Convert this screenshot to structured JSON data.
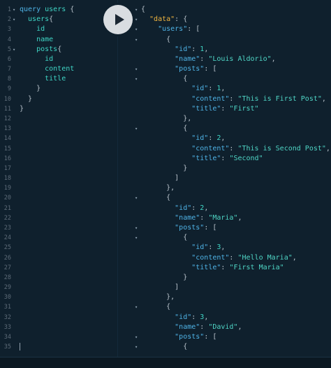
{
  "editor": {
    "lines": [
      {
        "n": "1",
        "fold": "▾",
        "indent": 0,
        "parts": [
          {
            "c": "kw",
            "t": "query"
          },
          {
            "c": "op",
            "t": " "
          },
          {
            "c": "fld",
            "t": "users"
          },
          {
            "c": "op",
            "t": " {"
          }
        ]
      },
      {
        "n": "2",
        "fold": "▾",
        "indent": 2,
        "parts": [
          {
            "c": "fld",
            "t": "users"
          },
          {
            "c": "op",
            "t": "{"
          }
        ]
      },
      {
        "n": "3",
        "fold": "",
        "indent": 4,
        "parts": [
          {
            "c": "fld",
            "t": "id"
          }
        ]
      },
      {
        "n": "4",
        "fold": "",
        "indent": 4,
        "parts": [
          {
            "c": "fld",
            "t": "name"
          }
        ]
      },
      {
        "n": "5",
        "fold": "▾",
        "indent": 4,
        "parts": [
          {
            "c": "fld",
            "t": "posts"
          },
          {
            "c": "op",
            "t": "{"
          }
        ]
      },
      {
        "n": "6",
        "fold": "",
        "indent": 6,
        "parts": [
          {
            "c": "fld",
            "t": "id"
          }
        ]
      },
      {
        "n": "7",
        "fold": "",
        "indent": 6,
        "parts": [
          {
            "c": "fld",
            "t": "content"
          }
        ]
      },
      {
        "n": "8",
        "fold": "",
        "indent": 6,
        "parts": [
          {
            "c": "fld",
            "t": "title"
          }
        ]
      },
      {
        "n": "9",
        "fold": "",
        "indent": 4,
        "parts": [
          {
            "c": "op",
            "t": "}"
          }
        ]
      },
      {
        "n": "10",
        "fold": "",
        "indent": 2,
        "parts": [
          {
            "c": "op",
            "t": "}"
          }
        ]
      },
      {
        "n": "11",
        "fold": "",
        "indent": 0,
        "parts": [
          {
            "c": "op",
            "t": "}"
          }
        ]
      },
      {
        "n": "12",
        "fold": "",
        "indent": 0,
        "parts": []
      },
      {
        "n": "13",
        "fold": "",
        "indent": 0,
        "parts": []
      },
      {
        "n": "14",
        "fold": "",
        "indent": 0,
        "parts": []
      },
      {
        "n": "15",
        "fold": "",
        "indent": 0,
        "parts": []
      },
      {
        "n": "16",
        "fold": "",
        "indent": 0,
        "parts": []
      },
      {
        "n": "17",
        "fold": "",
        "indent": 0,
        "parts": []
      },
      {
        "n": "18",
        "fold": "",
        "indent": 0,
        "parts": []
      },
      {
        "n": "19",
        "fold": "",
        "indent": 0,
        "parts": []
      },
      {
        "n": "20",
        "fold": "",
        "indent": 0,
        "parts": []
      },
      {
        "n": "21",
        "fold": "",
        "indent": 0,
        "parts": []
      },
      {
        "n": "22",
        "fold": "",
        "indent": 0,
        "parts": []
      },
      {
        "n": "23",
        "fold": "",
        "indent": 0,
        "parts": []
      },
      {
        "n": "24",
        "fold": "",
        "indent": 0,
        "parts": []
      },
      {
        "n": "25",
        "fold": "",
        "indent": 0,
        "parts": []
      },
      {
        "n": "26",
        "fold": "",
        "indent": 0,
        "parts": []
      },
      {
        "n": "27",
        "fold": "",
        "indent": 0,
        "parts": []
      },
      {
        "n": "28",
        "fold": "",
        "indent": 0,
        "parts": []
      },
      {
        "n": "29",
        "fold": "",
        "indent": 0,
        "parts": []
      },
      {
        "n": "30",
        "fold": "",
        "indent": 0,
        "parts": []
      },
      {
        "n": "31",
        "fold": "",
        "indent": 0,
        "parts": []
      },
      {
        "n": "32",
        "fold": "",
        "indent": 0,
        "parts": []
      },
      {
        "n": "33",
        "fold": "",
        "indent": 0,
        "parts": []
      },
      {
        "n": "34",
        "fold": "",
        "indent": 0,
        "parts": []
      },
      {
        "n": "35",
        "fold": "",
        "indent": 0,
        "parts": [],
        "cursor": true
      }
    ]
  },
  "run_button": {
    "icon": "play-icon"
  },
  "result": {
    "lines": [
      {
        "fold": "▾",
        "indent": 0,
        "parts": [
          {
            "c": "pun",
            "t": "{"
          }
        ]
      },
      {
        "fold": "▾",
        "indent": 2,
        "parts": [
          {
            "c": "dkey",
            "t": "\"data\""
          },
          {
            "c": "pun",
            "t": ": {"
          }
        ]
      },
      {
        "fold": "▾",
        "indent": 4,
        "parts": [
          {
            "c": "key",
            "t": "\"users\""
          },
          {
            "c": "pun",
            "t": ": ["
          }
        ]
      },
      {
        "fold": "▾",
        "indent": 6,
        "parts": [
          {
            "c": "pun",
            "t": "{"
          }
        ]
      },
      {
        "fold": "",
        "indent": 8,
        "parts": [
          {
            "c": "key",
            "t": "\"id\""
          },
          {
            "c": "pun",
            "t": ": "
          },
          {
            "c": "num",
            "t": "1"
          },
          {
            "c": "pun",
            "t": ","
          }
        ]
      },
      {
        "fold": "",
        "indent": 8,
        "parts": [
          {
            "c": "key",
            "t": "\"name\""
          },
          {
            "c": "pun",
            "t": ": "
          },
          {
            "c": "str",
            "t": "\"Louis Aldorio\""
          },
          {
            "c": "pun",
            "t": ","
          }
        ]
      },
      {
        "fold": "▾",
        "indent": 8,
        "parts": [
          {
            "c": "key",
            "t": "\"posts\""
          },
          {
            "c": "pun",
            "t": ": ["
          }
        ]
      },
      {
        "fold": "▾",
        "indent": 10,
        "parts": [
          {
            "c": "pun",
            "t": "{"
          }
        ]
      },
      {
        "fold": "",
        "indent": 12,
        "parts": [
          {
            "c": "key",
            "t": "\"id\""
          },
          {
            "c": "pun",
            "t": ": "
          },
          {
            "c": "num",
            "t": "1"
          },
          {
            "c": "pun",
            "t": ","
          }
        ]
      },
      {
        "fold": "",
        "indent": 12,
        "parts": [
          {
            "c": "key",
            "t": "\"content\""
          },
          {
            "c": "pun",
            "t": ": "
          },
          {
            "c": "str",
            "t": "\"This is First Post\""
          },
          {
            "c": "pun",
            "t": ","
          }
        ]
      },
      {
        "fold": "",
        "indent": 12,
        "parts": [
          {
            "c": "key",
            "t": "\"title\""
          },
          {
            "c": "pun",
            "t": ": "
          },
          {
            "c": "str",
            "t": "\"First\""
          }
        ]
      },
      {
        "fold": "",
        "indent": 10,
        "parts": [
          {
            "c": "pun",
            "t": "},"
          }
        ]
      },
      {
        "fold": "▾",
        "indent": 10,
        "parts": [
          {
            "c": "pun",
            "t": "{"
          }
        ]
      },
      {
        "fold": "",
        "indent": 12,
        "parts": [
          {
            "c": "key",
            "t": "\"id\""
          },
          {
            "c": "pun",
            "t": ": "
          },
          {
            "c": "num",
            "t": "2"
          },
          {
            "c": "pun",
            "t": ","
          }
        ]
      },
      {
        "fold": "",
        "indent": 12,
        "parts": [
          {
            "c": "key",
            "t": "\"content\""
          },
          {
            "c": "pun",
            "t": ": "
          },
          {
            "c": "str",
            "t": "\"This is Second Post\""
          },
          {
            "c": "pun",
            "t": ","
          }
        ]
      },
      {
        "fold": "",
        "indent": 12,
        "parts": [
          {
            "c": "key",
            "t": "\"title\""
          },
          {
            "c": "pun",
            "t": ": "
          },
          {
            "c": "str",
            "t": "\"Second\""
          }
        ]
      },
      {
        "fold": "",
        "indent": 10,
        "parts": [
          {
            "c": "pun",
            "t": "}"
          }
        ]
      },
      {
        "fold": "",
        "indent": 8,
        "parts": [
          {
            "c": "pun",
            "t": "]"
          }
        ]
      },
      {
        "fold": "",
        "indent": 6,
        "parts": [
          {
            "c": "pun",
            "t": "},"
          }
        ]
      },
      {
        "fold": "▾",
        "indent": 6,
        "parts": [
          {
            "c": "pun",
            "t": "{"
          }
        ]
      },
      {
        "fold": "",
        "indent": 8,
        "parts": [
          {
            "c": "key",
            "t": "\"id\""
          },
          {
            "c": "pun",
            "t": ": "
          },
          {
            "c": "num",
            "t": "2"
          },
          {
            "c": "pun",
            "t": ","
          }
        ]
      },
      {
        "fold": "",
        "indent": 8,
        "parts": [
          {
            "c": "key",
            "t": "\"name\""
          },
          {
            "c": "pun",
            "t": ": "
          },
          {
            "c": "str",
            "t": "\"Maria\""
          },
          {
            "c": "pun",
            "t": ","
          }
        ]
      },
      {
        "fold": "▾",
        "indent": 8,
        "parts": [
          {
            "c": "key",
            "t": "\"posts\""
          },
          {
            "c": "pun",
            "t": ": ["
          }
        ]
      },
      {
        "fold": "▾",
        "indent": 10,
        "parts": [
          {
            "c": "pun",
            "t": "{"
          }
        ]
      },
      {
        "fold": "",
        "indent": 12,
        "parts": [
          {
            "c": "key",
            "t": "\"id\""
          },
          {
            "c": "pun",
            "t": ": "
          },
          {
            "c": "num",
            "t": "3"
          },
          {
            "c": "pun",
            "t": ","
          }
        ]
      },
      {
        "fold": "",
        "indent": 12,
        "parts": [
          {
            "c": "key",
            "t": "\"content\""
          },
          {
            "c": "pun",
            "t": ": "
          },
          {
            "c": "str",
            "t": "\"Hello Maria\""
          },
          {
            "c": "pun",
            "t": ","
          }
        ]
      },
      {
        "fold": "",
        "indent": 12,
        "parts": [
          {
            "c": "key",
            "t": "\"title\""
          },
          {
            "c": "pun",
            "t": ": "
          },
          {
            "c": "str",
            "t": "\"First Maria\""
          }
        ]
      },
      {
        "fold": "",
        "indent": 10,
        "parts": [
          {
            "c": "pun",
            "t": "}"
          }
        ]
      },
      {
        "fold": "",
        "indent": 8,
        "parts": [
          {
            "c": "pun",
            "t": "]"
          }
        ]
      },
      {
        "fold": "",
        "indent": 6,
        "parts": [
          {
            "c": "pun",
            "t": "},"
          }
        ]
      },
      {
        "fold": "▾",
        "indent": 6,
        "parts": [
          {
            "c": "pun",
            "t": "{"
          }
        ]
      },
      {
        "fold": "",
        "indent": 8,
        "parts": [
          {
            "c": "key",
            "t": "\"id\""
          },
          {
            "c": "pun",
            "t": ": "
          },
          {
            "c": "num",
            "t": "3"
          },
          {
            "c": "pun",
            "t": ","
          }
        ]
      },
      {
        "fold": "",
        "indent": 8,
        "parts": [
          {
            "c": "key",
            "t": "\"name\""
          },
          {
            "c": "pun",
            "t": ": "
          },
          {
            "c": "str",
            "t": "\"David\""
          },
          {
            "c": "pun",
            "t": ","
          }
        ]
      },
      {
        "fold": "▾",
        "indent": 8,
        "parts": [
          {
            "c": "key",
            "t": "\"posts\""
          },
          {
            "c": "pun",
            "t": ": ["
          }
        ]
      },
      {
        "fold": "▾",
        "indent": 10,
        "parts": [
          {
            "c": "pun",
            "t": "{"
          }
        ]
      }
    ]
  }
}
